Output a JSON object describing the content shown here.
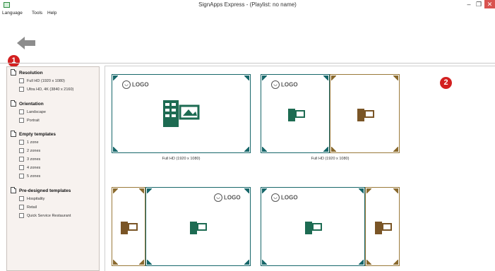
{
  "window": {
    "title": "SignApps Express - (Playlist: no name)",
    "minimize_glyph": "–",
    "restore_glyph": "❐",
    "close_glyph": "✕"
  },
  "menu": [
    {
      "label": "Language"
    },
    {
      "label": "Tools"
    },
    {
      "label": "Help"
    }
  ],
  "callouts": {
    "one": "1",
    "two": "2"
  },
  "sidebar": {
    "groups": [
      {
        "title": "Resolution",
        "options": [
          "Full HD (1920 x 1080)",
          "Ultra HD, 4K (3840 x 2160)"
        ]
      },
      {
        "title": "Orientation",
        "options": [
          "Landscape",
          "Portrait"
        ]
      },
      {
        "title": "Empty templates",
        "options": [
          "1 zone",
          "2 zones",
          "3 zones",
          "4 zones",
          "5 zones"
        ]
      },
      {
        "title": "Pre-designed templates",
        "options": [
          "Hospitality",
          "Retail",
          "Quick Service Restaurant"
        ]
      }
    ]
  },
  "templates": [
    {
      "logo": "LOGO",
      "caption": "Full HD (1920 x 1080)"
    },
    {
      "logo": "LOGO",
      "caption": "Full HD (1920 x 1080)"
    },
    {
      "logo": "LOGO",
      "caption": ""
    },
    {
      "logo": "LOGO",
      "caption": ""
    }
  ],
  "colors": {
    "teal": "#17676a",
    "gold": "#9a7a3a",
    "badge": "#d32020"
  }
}
